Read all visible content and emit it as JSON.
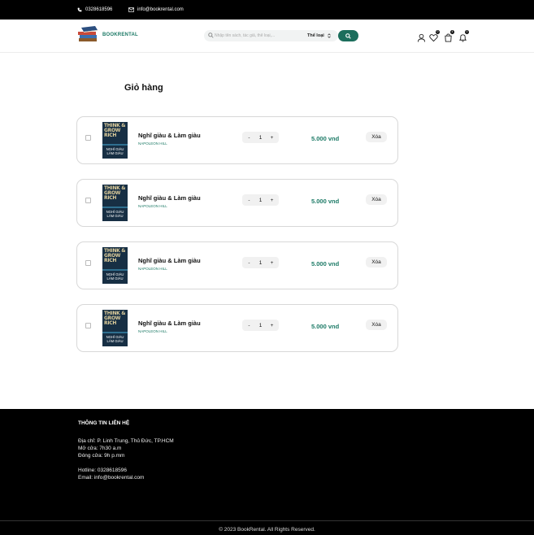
{
  "topbar": {
    "phone": "0328618596",
    "email": "info@bookrental.com"
  },
  "header": {
    "logo_text": "BOOKRENTAL",
    "search_placeholder": "Nhập tên sách, tác giả, thể loại,...",
    "category_label": "Thể loại",
    "icons": [
      "user-icon",
      "heart-icon",
      "cart-icon",
      "bell-icon"
    ],
    "badges": {
      "wishlist": "0",
      "cart": "4",
      "notifications": "0"
    }
  },
  "page_title": "Giỏ hàng",
  "cart_items": [
    {
      "title": "Nghĩ giàu & Làm giàu",
      "author": "NAPOLEON HILL",
      "quantity": "1",
      "price": "5.000 vnd",
      "delete_label": "Xóa",
      "cover_top": "THINK & GROW RICH",
      "cover_bottom": "NGHĨ GIÀU LÀM GIÀU"
    },
    {
      "title": "Nghĩ giàu & Làm giàu",
      "author": "NAPOLEON HILL",
      "quantity": "1",
      "price": "5.000 vnd",
      "delete_label": "Xóa",
      "cover_top": "THINK & GROW RICH",
      "cover_bottom": "NGHĨ GIÀU LÀM GIÀU"
    },
    {
      "title": "Nghĩ giàu & Làm giàu",
      "author": "NAPOLEON HILL",
      "quantity": "1",
      "price": "5.000 vnd",
      "delete_label": "Xóa",
      "cover_top": "THINK & GROW RICH",
      "cover_bottom": "NGHĨ GIÀU LÀM GIÀU"
    },
    {
      "title": "Nghĩ giàu & Làm giàu",
      "author": "NAPOLEON HILL",
      "quantity": "1",
      "price": "5.000 vnd",
      "delete_label": "Xóa",
      "cover_top": "THINK & GROW RICH",
      "cover_bottom": "NGHĨ GIÀU LÀM GIÀU"
    }
  ],
  "qty_minus": "-",
  "qty_plus": "+",
  "footer": {
    "heading": "THÔNG TIN LIÊN HỆ",
    "address": "Địa chỉ: P. Linh Trung, Thủ Đức, TP.HCM",
    "open": "Mở cửa: 7h30 a.m",
    "close": "Đóng cửa: 9h p.mm",
    "hotline": "Hotline: 0328618596",
    "email": "Email: info@bookrental.com",
    "copyright": "© 2023 BookRental. All Rights Reserved."
  },
  "colors": {
    "brand": "#1c7a66",
    "button": "#1c6e5c",
    "footer_bg": "#000000"
  }
}
